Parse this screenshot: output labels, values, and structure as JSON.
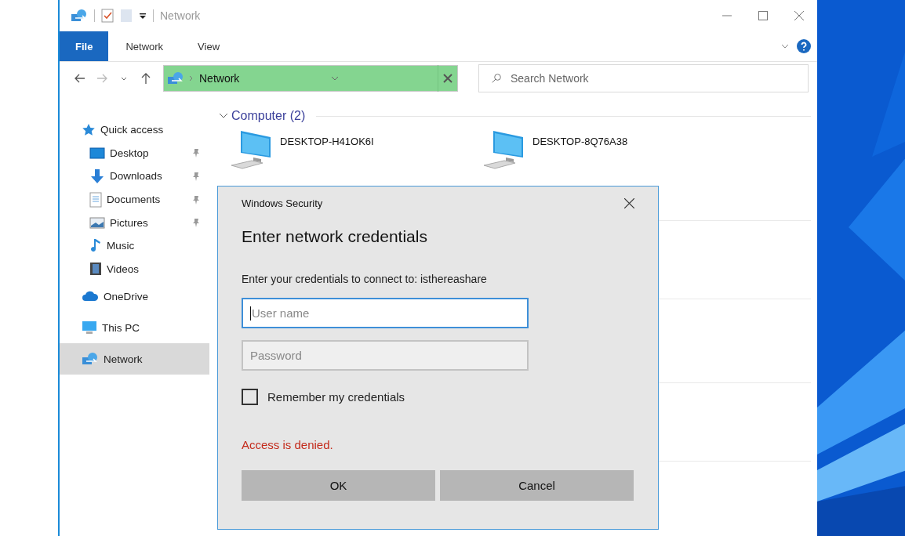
{
  "window": {
    "title": "Network"
  },
  "ribbon_tabs": [
    {
      "label": "File",
      "selected": true
    },
    {
      "label": "Network",
      "selected": false
    },
    {
      "label": "View",
      "selected": false
    }
  ],
  "address_bar": {
    "location": "Network"
  },
  "search": {
    "placeholder": "Search Network"
  },
  "navigation": [
    {
      "label": "Quick access",
      "kind": "star",
      "selected": false,
      "children": [
        {
          "label": "Desktop",
          "kind": "desktop",
          "pinned": true,
          "selected": false
        },
        {
          "label": "Downloads",
          "kind": "download",
          "pinned": true,
          "selected": false
        },
        {
          "label": "Documents",
          "kind": "document",
          "pinned": true,
          "selected": false
        },
        {
          "label": "Pictures",
          "kind": "pictures",
          "pinned": true,
          "selected": false
        },
        {
          "label": "Music",
          "kind": "music",
          "pinned": false,
          "selected": false
        },
        {
          "label": "Videos",
          "kind": "videos",
          "pinned": false,
          "selected": false
        }
      ]
    },
    {
      "label": "OneDrive",
      "kind": "cloud",
      "selected": false
    },
    {
      "label": "This PC",
      "kind": "pc",
      "selected": false
    },
    {
      "label": "Network",
      "kind": "network",
      "selected": true
    }
  ],
  "content": {
    "group": {
      "title": "Computer (2)",
      "expanded": true
    },
    "items": [
      {
        "name": "DESKTOP-H41OK6I"
      },
      {
        "name": "DESKTOP-8Q76A38"
      }
    ]
  },
  "dialog": {
    "caption": "Windows Security",
    "heading": "Enter network credentials",
    "message": "Enter your credentials to connect to: isthereashare",
    "fields": [
      {
        "placeholder": "User name",
        "focused": true
      },
      {
        "placeholder": "Password",
        "focused": false
      }
    ],
    "remember": {
      "label": "Remember my credentials",
      "checked": false
    },
    "error": "Access is denied.",
    "buttons": [
      "OK",
      "Cancel"
    ]
  }
}
